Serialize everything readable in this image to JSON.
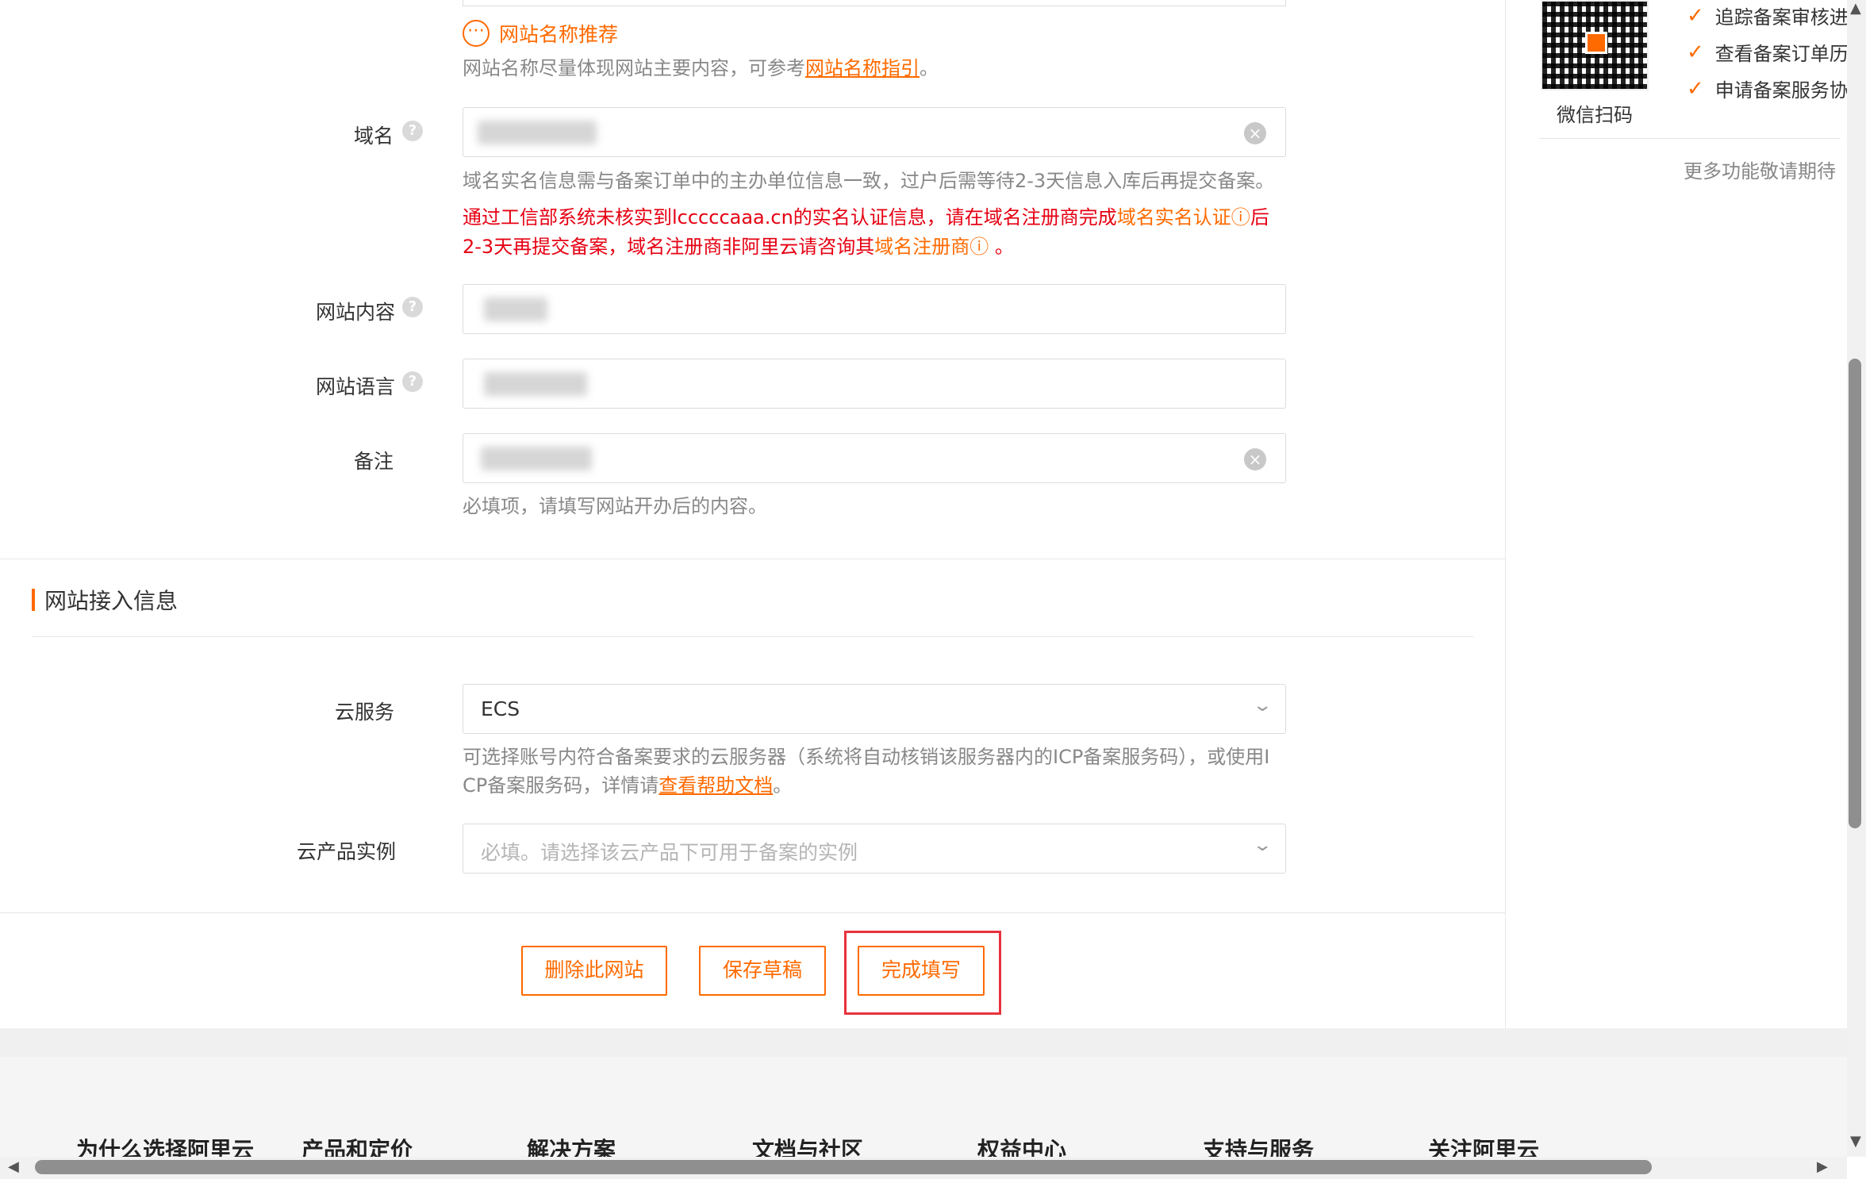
{
  "form": {
    "name_suggestion": "网站名称推荐",
    "name_hint_prefix": "网站名称尽量体现网站主要内容，可参考",
    "name_hint_link": "网站名称指引",
    "name_hint_suffix": "。",
    "domain_label": "域名",
    "domain_hint": "域名实名信息需与备案订单中的主办单位信息一致，过户后需等待2-3天信息入库后再提交备案。",
    "domain_error_1": "通过工信部系统未核实到lcccccaaa.cn的实名认证信息，请在域名注册商完成",
    "domain_error_link1": "域名实名认证ⓘ",
    "domain_error_2": "后2-3天再提交备案，域名注册商非阿里云请咨询其",
    "domain_error_link2": "域名注册商ⓘ",
    "domain_error_3": " 。",
    "content_label": "网站内容",
    "language_label": "网站语言",
    "remark_label": "备注",
    "remark_hint": "必填项，请填写网站开办后的内容。"
  },
  "access_section": {
    "title": "网站接入信息",
    "cloud_service_label": "云服务",
    "cloud_service_value": "ECS",
    "cloud_hint_1": "可选择账号内符合备案要求的云服务器（系统将自动核销该服务器内的ICP备案服务码），或使用I",
    "cloud_hint_2": "CP备案服务码，详情请",
    "cloud_hint_link": "查看帮助文档",
    "cloud_hint_end": "。",
    "instance_label": "云产品实例",
    "instance_placeholder": "必填。请选择该云产品下可用于备案的实例"
  },
  "actions": {
    "delete": "删除此网站",
    "save_draft": "保存草稿",
    "complete": "完成填写"
  },
  "sidebar": {
    "qr_caption": "微信扫码",
    "items": [
      "追踪备案审核进",
      "查看备案订单历",
      "申请备案服务协"
    ],
    "more": "更多功能敬请期待"
  },
  "footer": {
    "columns": [
      "为什么选择阿里云",
      "产品和定价",
      "解决方案",
      "文档与社区",
      "权益中心",
      "支持与服务",
      "关注阿里云"
    ]
  },
  "colors": {
    "accent": "#ff6a00",
    "error": "#e60012",
    "highlight": "#e8323c"
  }
}
